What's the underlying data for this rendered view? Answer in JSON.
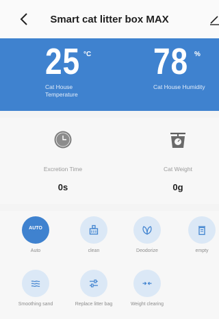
{
  "header": {
    "title": "Smart cat litter box MAX"
  },
  "stats": {
    "temperature": {
      "value": "25",
      "unit": "°C",
      "label": "Cat House Temperature"
    },
    "humidity": {
      "value": "78",
      "unit": "%",
      "label": "Cat House Humidity"
    }
  },
  "metrics": {
    "excretion": {
      "label": "Excretion Time",
      "value": "0s",
      "icon": "clock-icon"
    },
    "weight": {
      "label": "Cat Weight",
      "value": "0g",
      "icon": "scale-icon"
    }
  },
  "controls": [
    {
      "label": "Auto",
      "icon_text": "AUTO",
      "icon": "auto-icon",
      "active": true
    },
    {
      "label": "clean",
      "icon": "clean-icon"
    },
    {
      "label": "Deodorize",
      "icon": "leaf-icon"
    },
    {
      "label": "empty",
      "icon": "bin-icon"
    },
    {
      "label": "Smoothing sand",
      "icon": "waves-icon"
    },
    {
      "label": "Replace litter bag",
      "icon": "sliders-icon"
    },
    {
      "label": "Weight clearing",
      "icon": "arrows-icon"
    }
  ],
  "colors": {
    "accent": "#3f82cf",
    "button_bg": "#dbe8f6"
  }
}
